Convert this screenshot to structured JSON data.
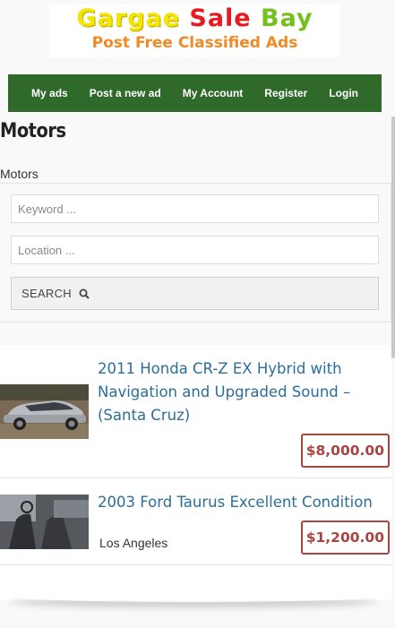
{
  "logo": {
    "line1_word1": "Gargae",
    "line1_word2": "Sale",
    "line1_word3": "Bay",
    "line2": "Post Free Classified Ads"
  },
  "nav": {
    "items": [
      "My ads",
      "Post a new ad",
      "My Account",
      "Register",
      "Login"
    ],
    "background": "#2f6a2b"
  },
  "page": {
    "title": "Motors",
    "breadcrumb": "Motors"
  },
  "search": {
    "keyword_placeholder": "Keyword ...",
    "location_placeholder": "Location ...",
    "button_label": "SEARCH",
    "button_icon": "search-icon"
  },
  "listings": [
    {
      "title": "2011 Honda CR-Z EX Hybrid with Navigation and Upgraded Sound – (Santa Cruz)",
      "location": "",
      "price": "$8,000.00",
      "image": "silver-hatchback-photo"
    },
    {
      "title": "2003 Ford Taurus Excellent Condition",
      "location": "Los Angeles",
      "price": "$1,200.00",
      "image": "car-interior-photo"
    }
  ],
  "colors": {
    "link": "#2b6e9a",
    "price": "#a94442"
  }
}
